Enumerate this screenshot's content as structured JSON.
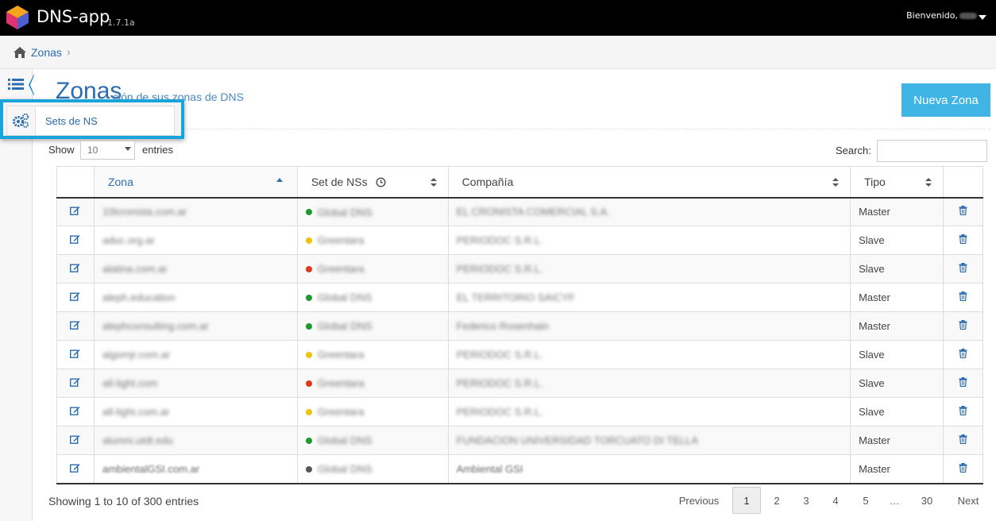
{
  "app": {
    "name": "DNS-app",
    "version": "1.7.1a",
    "welcome": "Bienvenido,"
  },
  "breadcrumb": {
    "items": [
      "Zonas"
    ]
  },
  "sidebar": {
    "popout_item": "Sets de NS"
  },
  "header": {
    "title": "Zonas",
    "subtitle": "ción de sus zonas de DNS",
    "new_button": "Nueva Zona"
  },
  "controls": {
    "show_label": "Show",
    "page_length": "10",
    "entries_label": "entries",
    "search_label": "Search:",
    "search_value": ""
  },
  "table": {
    "columns": [
      "Zona",
      "Set de NSs",
      "Compañía",
      "Tipo"
    ],
    "rows": [
      {
        "zona": "10lcronista.com.ar",
        "set": "Global DNS",
        "status": "green",
        "company": "EL CRONISTA COMERCIAL S.A.",
        "tipo": "Master"
      },
      {
        "zona": "aduc.org.ar",
        "set": "Greentara",
        "status": "yellow",
        "company": "PERIODOC S.R.L.",
        "tipo": "Slave"
      },
      {
        "zona": "alatina.com.ar",
        "set": "Greentara",
        "status": "red",
        "company": "PERIODOC S.R.L.",
        "tipo": "Slave"
      },
      {
        "zona": "aleph.education",
        "set": "Global DNS",
        "status": "green",
        "company": "EL TERRITORIO SAICYF",
        "tipo": "Master"
      },
      {
        "zona": "alephconsulting.com.ar",
        "set": "Global DNS",
        "status": "green",
        "company": "Federico Rosenhain",
        "tipo": "Master"
      },
      {
        "zona": "algomjr.com.ar",
        "set": "Greentara",
        "status": "yellow",
        "company": "PERIODOC S.R.L.",
        "tipo": "Slave"
      },
      {
        "zona": "all-light.com",
        "set": "Greentara",
        "status": "red",
        "company": "PERIODOC S.R.L.",
        "tipo": "Slave"
      },
      {
        "zona": "all-light.com.ar",
        "set": "Greentara",
        "status": "yellow",
        "company": "PERIODOC S.R.L.",
        "tipo": "Slave"
      },
      {
        "zona": "alumni.utdt.edu",
        "set": "Global DNS",
        "status": "green",
        "company": "FUNDACION UNIVERSIDAD TORCUATO DI TELLA",
        "tipo": "Master"
      },
      {
        "zona": "ambientalGSI.com.ar",
        "set": "Global DNS",
        "status": "gray",
        "company": "Ambiental GSI",
        "tipo": "Master"
      }
    ]
  },
  "status_colors": {
    "green": "#1f9a2b",
    "yellow": "#f2c10a",
    "red": "#e2391c",
    "gray": "#555555"
  },
  "footer": {
    "info": "Showing 1 to 10 of 300 entries",
    "previous": "Previous",
    "pages": [
      "1",
      "2",
      "3",
      "4",
      "5",
      "…",
      "30"
    ],
    "next": "Next"
  },
  "colors": {
    "accent": "#2a6db1",
    "button": "#3fb5e5",
    "highlight_border": "#1aa4dc"
  }
}
